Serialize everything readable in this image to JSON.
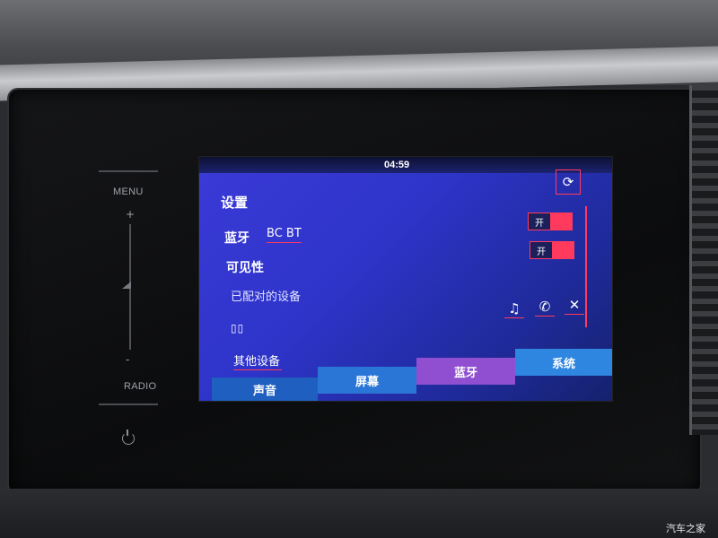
{
  "status_bar": {
    "time": "04:59"
  },
  "hardware": {
    "menu_label": "MENU",
    "plus": "+",
    "minus": "-",
    "radio_label": "RADIO"
  },
  "page": {
    "title": "设置"
  },
  "bluetooth": {
    "label": "蓝牙",
    "device_name": "BC BT",
    "toggle_text": "开"
  },
  "visibility": {
    "label": "可见性",
    "toggle_text": "开"
  },
  "paired": {
    "label": "已配对的设备",
    "device": "▯▯",
    "icons": [
      "music-icon",
      "phone-icon",
      "close-icon"
    ]
  },
  "other_devices": {
    "label": "其他设备"
  },
  "tabs": [
    {
      "label": "声音"
    },
    {
      "label": "屏幕"
    },
    {
      "label": "蓝牙"
    },
    {
      "label": "系统"
    }
  ],
  "colors": {
    "accent": "#ff3a5c",
    "screen_bg": "#2e34c9",
    "active_tab": "#8f4fd0"
  },
  "watermark": "汽车之家"
}
